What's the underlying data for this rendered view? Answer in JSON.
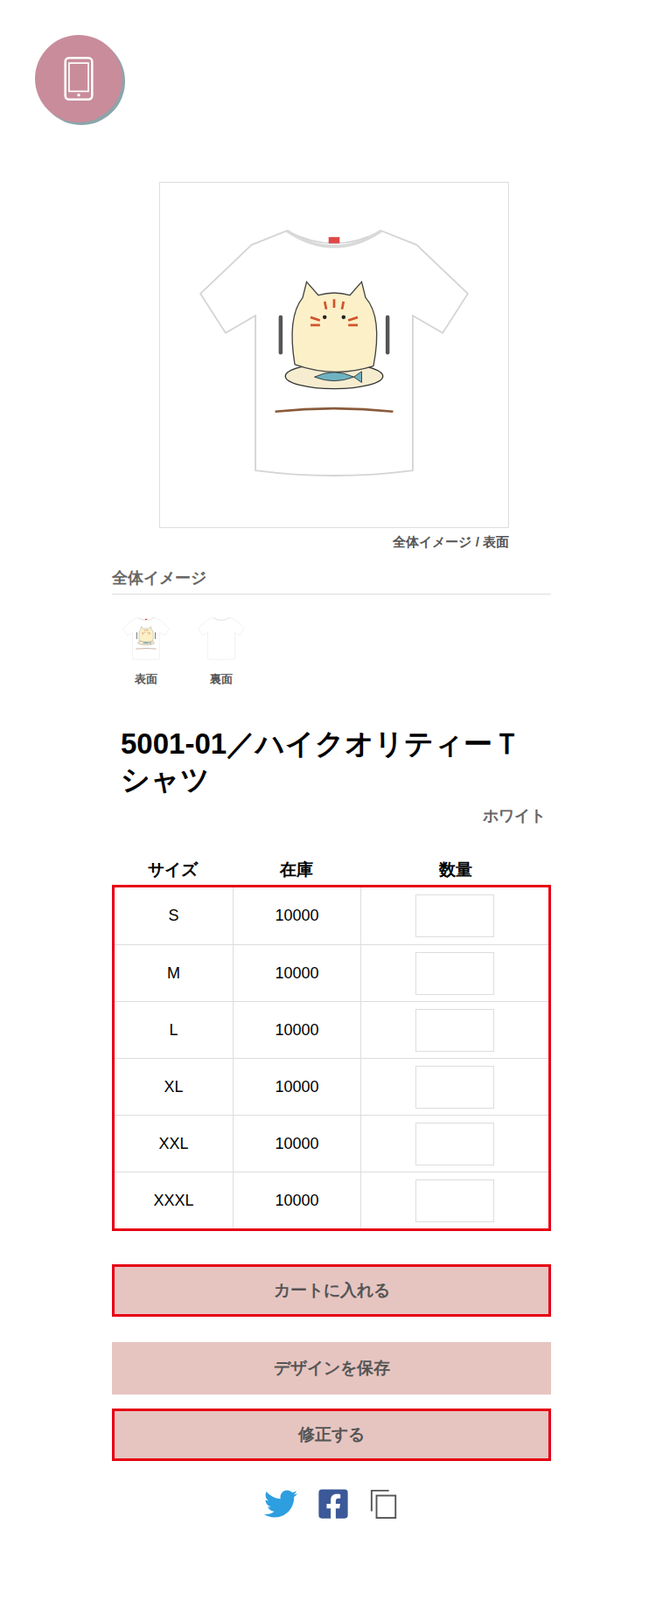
{
  "preview": {
    "caption": "全体イメージ / 表面",
    "kind": "printed"
  },
  "thumbnails": {
    "heading": "全体イメージ",
    "items": [
      {
        "label": "表面",
        "kind": "printed"
      },
      {
        "label": "裏面",
        "kind": "plain"
      }
    ]
  },
  "product": {
    "title": "5001-01／ハイクオリティーＴシャツ",
    "color": "ホワイト"
  },
  "table": {
    "highlighted": true,
    "columns": [
      "サイズ",
      "在庫",
      "数量"
    ],
    "rows": [
      {
        "size": "S",
        "stock": "10000",
        "quantity": ""
      },
      {
        "size": "M",
        "stock": "10000",
        "quantity": ""
      },
      {
        "size": "L",
        "stock": "10000",
        "quantity": ""
      },
      {
        "size": "XL",
        "stock": "10000",
        "quantity": ""
      },
      {
        "size": "XXL",
        "stock": "10000",
        "quantity": ""
      },
      {
        "size": "XXXL",
        "stock": "10000",
        "quantity": ""
      }
    ]
  },
  "buttons": [
    {
      "label": "カートに入れる",
      "highlighted": true
    },
    {
      "label": "デザインを保存",
      "highlighted": false
    },
    {
      "label": "修正する",
      "highlighted": true
    }
  ]
}
